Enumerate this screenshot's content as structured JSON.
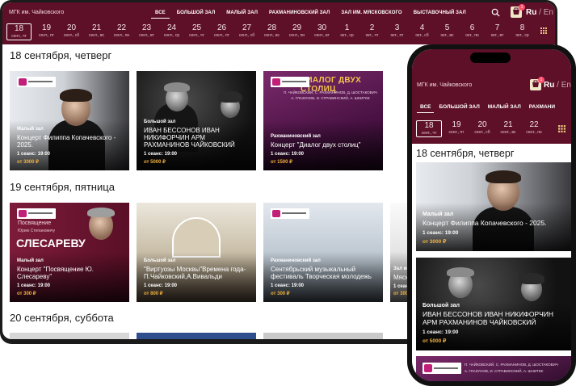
{
  "header": {
    "brand": "МГК им. Чайковского",
    "halls": [
      "ВСЕ",
      "БОЛЬШОЙ ЗАЛ",
      "МАЛЫЙ ЗАЛ",
      "РАХМАНИНОВСКИЙ ЗАЛ",
      "ЗАЛ ИМ. МЯСКОВСКОГО",
      "ВЫСТАВОЧНЫЙ ЗАЛ"
    ],
    "cart_count": "1",
    "lang_ru": "Ru",
    "lang_sep": "/",
    "lang_en": "En",
    "dates": [
      {
        "d": "18",
        "w": "сент., чт"
      },
      {
        "d": "19",
        "w": "сент., пт"
      },
      {
        "d": "20",
        "w": "сент., сб"
      },
      {
        "d": "21",
        "w": "сент., вс"
      },
      {
        "d": "22",
        "w": "сент., пн"
      },
      {
        "d": "23",
        "w": "сент., вт"
      },
      {
        "d": "24",
        "w": "сент., ср"
      },
      {
        "d": "25",
        "w": "сент., чт"
      },
      {
        "d": "26",
        "w": "сент., пт"
      },
      {
        "d": "27",
        "w": "сент., сб"
      },
      {
        "d": "28",
        "w": "сент., вс"
      },
      {
        "d": "29",
        "w": "сент., пн"
      },
      {
        "d": "30",
        "w": "сент., вт"
      },
      {
        "d": "1",
        "w": "окт., ср"
      },
      {
        "d": "2",
        "w": "окт., чт"
      },
      {
        "d": "3",
        "w": "окт., пт"
      },
      {
        "d": "4",
        "w": "окт., сб"
      },
      {
        "d": "5",
        "w": "окт., вс"
      },
      {
        "d": "6",
        "w": "окт., пн"
      },
      {
        "d": "7",
        "w": "окт., вт"
      },
      {
        "d": "8",
        "w": "окт., ср"
      }
    ]
  },
  "days": [
    {
      "label": "18 сентября, четверг",
      "events": [
        {
          "hall": "Малый зал",
          "title": "Концерт Филиппа Копачевского - 2025.",
          "session": "1 сеанс: 19:00",
          "price": "от 3000 ₽"
        },
        {
          "hall": "Большой зал",
          "title": "ИВАН БЕССОНОВ ИВАН НИКИФОРЧИН АРМ РАХМАНИНОВ ЧАЙКОВСКИЙ",
          "session": "1 сеанс: 19:00",
          "price": "от 5000 ₽"
        },
        {
          "hall": "Рахманиновский зал",
          "title": "Концерт \"Диалог двух столиц\"",
          "session": "1 сеанс: 19:00",
          "price": "от 1500 ₽",
          "poster_title": "ДИАЛОГ ДВУХ СТОЛИЦ",
          "poster_sub": "П. ЧАЙКОВСКИЙ, С. РАХМАНИНОВ, Д. ШОСТАКОВИЧ",
          "poster_sub2": "А. ГЛАЗУНОВ, И. СТРАВИНСКИЙ, А. ШНИТКЕ"
        }
      ]
    },
    {
      "label": "19 сентября, пятница",
      "events": [
        {
          "hall": "Малый зал",
          "title": "Концерт \"Посвящение Ю. Слесареву\"",
          "session": "1 сеанс: 19:00",
          "price": "от 300 ₽",
          "poster_title": "Посвящение",
          "poster_name": "СЛЕСАРЕВУ",
          "poster_sub": "Юрию Степановичу"
        },
        {
          "hall": "Большой зал",
          "title": "\"Виртуозы Москвы\"Времена года-П.Чайковский,А.Вивальди",
          "session": "1 сеанс: 19:00",
          "price": "от 800 ₽"
        },
        {
          "hall": "Рахманиновский зал",
          "title": "Сентябрьский музыкальный фестиваль Творческая молодежь",
          "session": "1 сеанс: 19:00",
          "price": "от 300 ₽"
        },
        {
          "hall": "Зал им.",
          "title": "Мяско",
          "session": "1 сеанс:",
          "price": "от 300"
        }
      ]
    },
    {
      "label": "20 сентября, суббота",
      "events": []
    }
  ],
  "phone": {
    "halls": [
      "ВСЕ",
      "БОЛЬШОЙ ЗАЛ",
      "МАЛЫЙ ЗАЛ",
      "РАХМАНИ"
    ],
    "dates": [
      {
        "d": "18",
        "w": "сент., чт"
      },
      {
        "d": "19",
        "w": "сент., пт"
      },
      {
        "d": "20",
        "w": "сент., сб"
      },
      {
        "d": "21",
        "w": "сент., вс"
      },
      {
        "d": "22",
        "w": "сент., пн"
      }
    ],
    "day_label": "18 сентября, четверг",
    "events": [
      {
        "hall": "Малый зал",
        "title": "Концерт Филиппа Копачевского - 2025.",
        "session": "1 сеанс: 19:00",
        "price": "от 3000 ₽"
      },
      {
        "hall": "Большой зал",
        "title": "ИВАН БЕССОНОВ ИВАН НИКИФОРЧИН АРМ РАХМАНИНОВ ЧАЙКОВСКИЙ",
        "session": "1 сеанс: 19:00",
        "price": "от 5000 ₽"
      },
      {
        "poster_sub": "П. ЧАЙКОВСКИЙ, С. РАХМАНИНОВ, Д. ШОСТАКОВИЧ",
        "poster_sub2": "А. ГЛАЗУНОВ, И. СТРАВИНСКИЙ, А. ШНИТКЕ"
      }
    ]
  },
  "colors": {
    "brand": "#5e1029",
    "price": "#f0b03e",
    "badge": "#ff4f6c"
  },
  "icons": [
    "search-icon",
    "cart-icon",
    "calendar-icon"
  ]
}
